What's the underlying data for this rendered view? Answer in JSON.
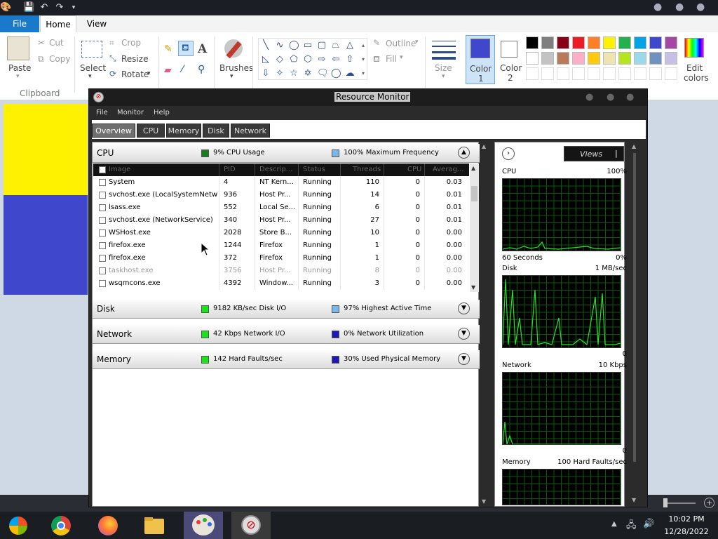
{
  "paint": {
    "tabs": {
      "file": "File",
      "home": "Home",
      "view": "View"
    },
    "clipboard": {
      "paste": "Paste",
      "cut": "Cut",
      "copy": "Copy",
      "group": "Clipboard"
    },
    "image": {
      "select": "Select",
      "crop": "Crop",
      "resize": "Resize",
      "rotate": "Rotate"
    },
    "brushes": "Brushes",
    "shapes": {
      "outline": "Outline",
      "fill": "Fill"
    },
    "size": "Size",
    "color1": {
      "line1": "Color",
      "line2": "1",
      "value": "#3f48cc"
    },
    "color2": {
      "line1": "Color",
      "line2": "2",
      "value": "#ffffff"
    },
    "edit_colors": {
      "line1": "Edit",
      "line2": "colors"
    },
    "palette_row1": [
      "#000000",
      "#7f7f7f",
      "#880015",
      "#ed1c24",
      "#ff7f27",
      "#fff200",
      "#22b14c",
      "#00a2e8",
      "#3f48cc",
      "#a349a4"
    ],
    "palette_row2": [
      "#ffffff",
      "#c3c3c3",
      "#b97a57",
      "#ffaec9",
      "#ffc90e",
      "#efe4b0",
      "#b5e61d",
      "#99d9ea",
      "#7092be",
      "#c8bfe7"
    ]
  },
  "resmon": {
    "title": "Resource Monitor",
    "menu": [
      "File",
      "Monitor",
      "Help"
    ],
    "tabs": [
      "Overview",
      "CPU",
      "Memory",
      "Disk",
      "Network"
    ],
    "cpu": {
      "name": "CPU",
      "usage": "9% CPU Usage",
      "freq": "100% Maximum Frequency",
      "columns": [
        "Image",
        "PID",
        "Descrip...",
        "Status",
        "Threads",
        "CPU",
        "Averag..."
      ],
      "rows": [
        [
          "System",
          "4",
          "NT Kern...",
          "Running",
          "110",
          "0",
          "0.03"
        ],
        [
          "svchost.exe (LocalSystemNetw...",
          "936",
          "Host Pr...",
          "Running",
          "14",
          "0",
          "0.01"
        ],
        [
          "lsass.exe",
          "552",
          "Local Se...",
          "Running",
          "6",
          "0",
          "0.01"
        ],
        [
          "svchost.exe (NetworkService)",
          "340",
          "Host Pr...",
          "Running",
          "27",
          "0",
          "0.01"
        ],
        [
          "WSHost.exe",
          "2028",
          "Store B...",
          "Running",
          "10",
          "0",
          "0.00"
        ],
        [
          "firefox.exe",
          "1244",
          "Firefox",
          "Running",
          "1",
          "0",
          "0.00"
        ],
        [
          "firefox.exe",
          "372",
          "Firefox",
          "Running",
          "1",
          "0",
          "0.00"
        ],
        [
          "taskhost.exe",
          "3756",
          "Host Pr...",
          "Running",
          "8",
          "0",
          "0.00"
        ],
        [
          "wsqmcons.exe",
          "4392",
          "Window...",
          "Running",
          "3",
          "0",
          "0.00"
        ]
      ]
    },
    "disk": {
      "name": "Disk",
      "io": "9182 KB/sec Disk I/O",
      "active": "97% Highest Active Time"
    },
    "network": {
      "name": "Network",
      "io": "42 Kbps Network I/O",
      "util": "0% Network Utilization"
    },
    "memory": {
      "name": "Memory",
      "faults": "142 Hard Faults/sec",
      "used": "30% Used Physical Memory"
    },
    "views_label": "Views",
    "graphs": {
      "cpu": {
        "label": "CPU",
        "max": "100%",
        "left_bottom": "60 Seconds",
        "right_bottom": "0%"
      },
      "disk": {
        "label": "Disk",
        "max": "1 MB/sec",
        "right_bottom": "0"
      },
      "network": {
        "label": "Network",
        "max": "10 Kbps",
        "right_bottom": "0"
      },
      "memory": {
        "label": "Memory",
        "max": "100 Hard Faults/sec"
      }
    }
  },
  "taskbar": {
    "time": "10:02 PM",
    "date": "12/28/2022"
  }
}
